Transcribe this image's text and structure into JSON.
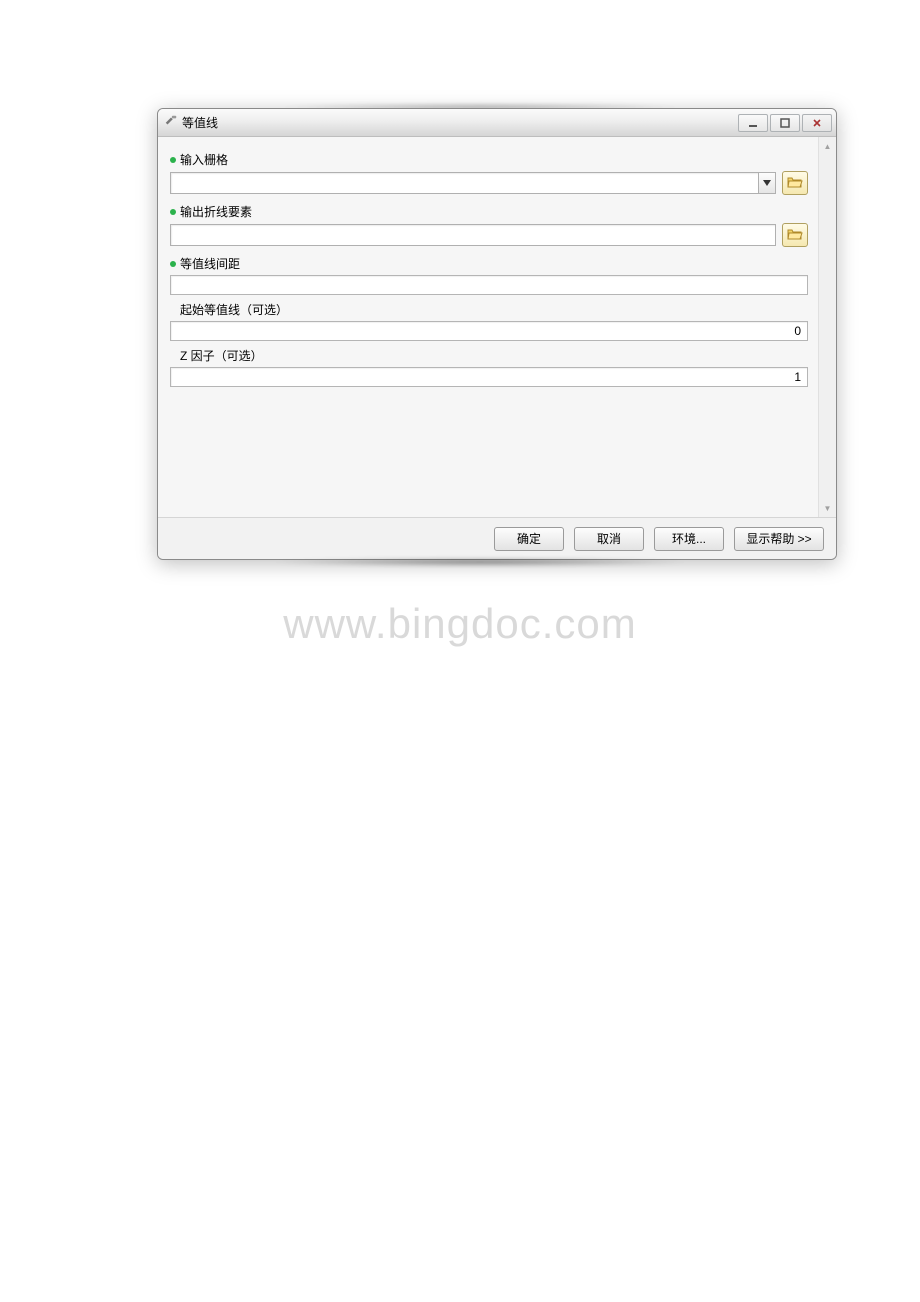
{
  "window": {
    "title": "等值线"
  },
  "fields": {
    "input_raster": {
      "label": "输入栅格",
      "value": ""
    },
    "output_polyline": {
      "label": "输出折线要素",
      "value": ""
    },
    "contour_interval": {
      "label": "等值线间距",
      "value": ""
    },
    "base_contour": {
      "label": "起始等值线（可选）",
      "value": "0"
    },
    "z_factor": {
      "label": "Z 因子（可选）",
      "value": "1"
    }
  },
  "buttons": {
    "ok": "确定",
    "cancel": "取消",
    "environments": "环境...",
    "show_help": "显示帮助 >>"
  },
  "watermark": "www.bingdoc.com"
}
